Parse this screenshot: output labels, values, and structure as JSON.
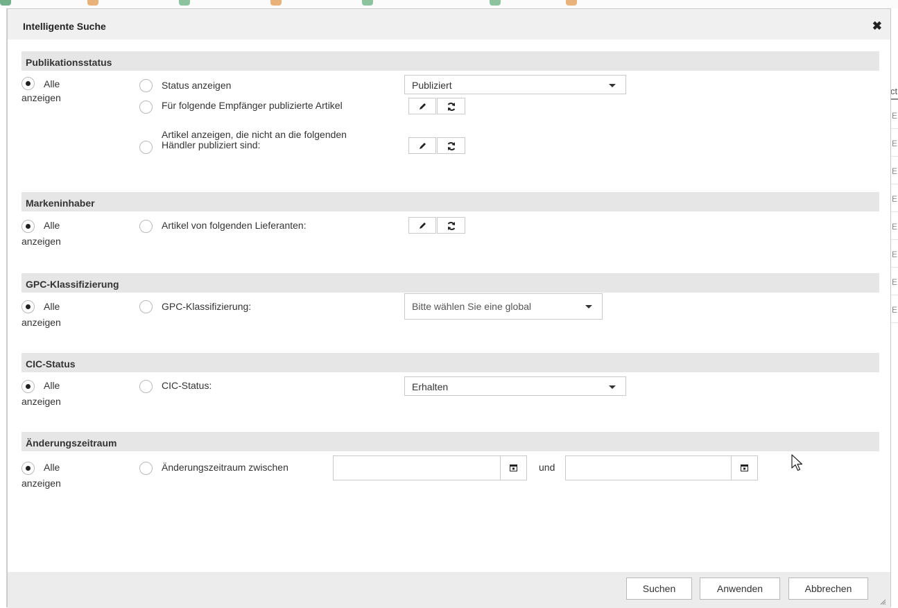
{
  "dialog": {
    "title": "Intelligente Suche",
    "close_symbol": "✖"
  },
  "sections": {
    "publication": {
      "header": "Publikationsstatus",
      "all_label_1": "Alle",
      "all_label_2": "anzeigen",
      "status_label": "Status anzeigen",
      "status_value": "Publiziert",
      "recipients_label": "Für folgende Empfänger publizierte Artikel",
      "not_published_line1": "Artikel anzeigen, die nicht an die folgenden",
      "not_published_line2": "Händler publiziert sind:"
    },
    "brand": {
      "header": "Markeninhaber",
      "all_label_1": "Alle",
      "all_label_2": "anzeigen",
      "suppliers_label": "Artikel von folgenden Lieferanten:"
    },
    "gpc": {
      "header": "GPC-Klassifizierung",
      "all_label_1": "Alle",
      "all_label_2": "anzeigen",
      "gpc_label": "GPC-Klassifizierung:",
      "gpc_placeholder": "Bitte wählen Sie eine global"
    },
    "cic": {
      "header": "CIC-Status",
      "all_label_1": "Alle",
      "all_label_2": "anzeigen",
      "cic_label": "CIC-Status:",
      "cic_value": "Erhalten"
    },
    "period": {
      "header": "Änderungszeitraum",
      "all_label_1": "Alle",
      "all_label_2": "anzeigen",
      "period_label": "Änderungszeitraum zwischen",
      "and_label": "und",
      "from_value": "",
      "to_value": ""
    }
  },
  "footer": {
    "search_label": "Suchen",
    "apply_label": "Anwenden",
    "cancel_label": "Abbrechen"
  },
  "background": {
    "column_header_fragment": "ct",
    "row_fragment": "E"
  }
}
